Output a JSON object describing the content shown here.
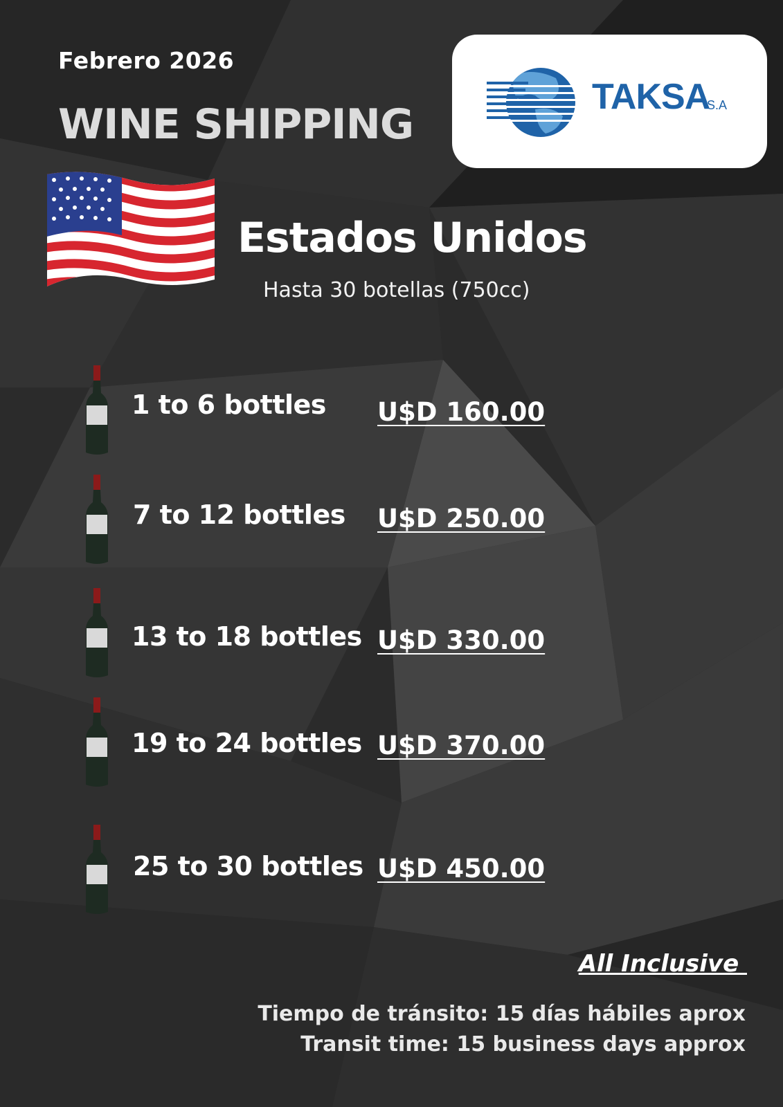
{
  "header": {
    "date": "Febrero 2026",
    "title": "WINE SHIPPING"
  },
  "logo": {
    "brand": "TAKSA",
    "suffix": "S.A",
    "brand_color": "#1f63a8",
    "icon": "globe-icon"
  },
  "destination": {
    "country": "Estados Unidos",
    "subtitle": "Hasta 30 botellas (750cc)",
    "flag_icon": "us-flag-icon"
  },
  "rates": [
    {
      "label": "1 to 6 bottles",
      "price": "U$D 160.00"
    },
    {
      "label": "7 to 12 bottles",
      "price": "U$D 250.00"
    },
    {
      "label": "13 to 18 bottles",
      "price": "U$D 330.00"
    },
    {
      "label": "19 to 24 bottles",
      "price": "U$D 370.00"
    },
    {
      "label": "25 to 30 bottles",
      "price": "U$D 450.00"
    }
  ],
  "footer": {
    "all_inclusive": "All Inclusive ",
    "transit_es": "Tiempo de tránsito: 15 días hábiles aprox",
    "transit_en": "Transit time: 15 business days approx"
  }
}
